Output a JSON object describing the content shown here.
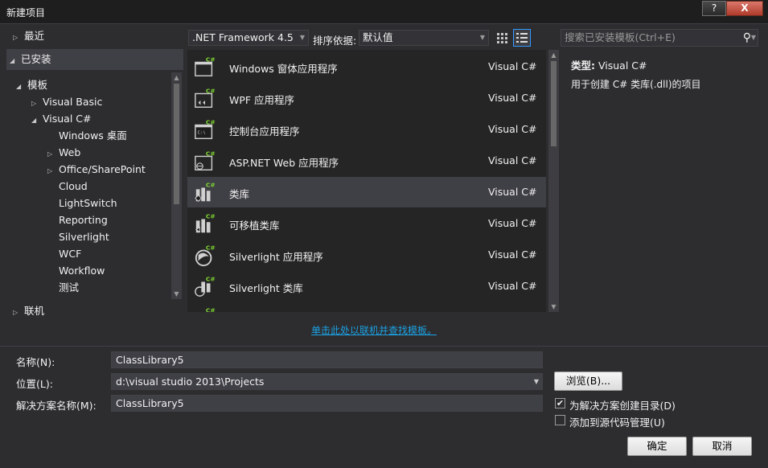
{
  "window": {
    "title": "新建项目",
    "help_label": "?",
    "close_label": "X"
  },
  "tree": {
    "recent": "最近",
    "installed": "已安装",
    "templates": "模板",
    "visual_basic": "Visual Basic",
    "visual_csharp": "Visual C#",
    "children": [
      "Windows 桌面",
      "Web",
      "Office/SharePoint",
      "Cloud",
      "LightSwitch",
      "Reporting",
      "Silverlight",
      "WCF",
      "Workflow",
      "测试"
    ],
    "online": "联机"
  },
  "toolbar": {
    "framework": ".NET Framework 4.5",
    "sort_label": "排序依据:",
    "sort_value": "默认值",
    "search_placeholder": "搜索已安装模板(Ctrl+E)"
  },
  "templates": [
    {
      "name": "Windows 窗体应用程序",
      "lang": "Visual C#"
    },
    {
      "name": "WPF 应用程序",
      "lang": "Visual C#"
    },
    {
      "name": "控制台应用程序",
      "lang": "Visual C#"
    },
    {
      "name": "ASP.NET Web 应用程序",
      "lang": "Visual C#"
    },
    {
      "name": "类库",
      "lang": "Visual C#"
    },
    {
      "name": "可移植类库",
      "lang": "Visual C#"
    },
    {
      "name": "Silverlight 应用程序",
      "lang": "Visual C#"
    },
    {
      "name": "Silverlight 类库",
      "lang": "Visual C#"
    }
  ],
  "icon_badge": "C#",
  "details": {
    "type_label": "类型:",
    "type_value": "Visual C#",
    "description": "用于创建 C# 类库(.dll)的项目"
  },
  "online_link": "单击此处以联机并查找模板。",
  "form": {
    "name_label": "名称(N):",
    "name_value": "ClassLibrary5",
    "location_label": "位置(L):",
    "location_value": "d:\\visual studio 2013\\Projects",
    "solution_label": "解决方案名称(M):",
    "solution_value": "ClassLibrary5",
    "browse_label": "浏览(B)...",
    "create_dir_label": "为解决方案创建目录(D)",
    "source_control_label": "添加到源代码管理(U)",
    "ok_label": "确定",
    "cancel_label": "取消"
  },
  "colors": {
    "accent": "#1ba1e2",
    "badge": "#7fd62f",
    "selection": "#3f3f46",
    "background": "#2d2d30"
  }
}
